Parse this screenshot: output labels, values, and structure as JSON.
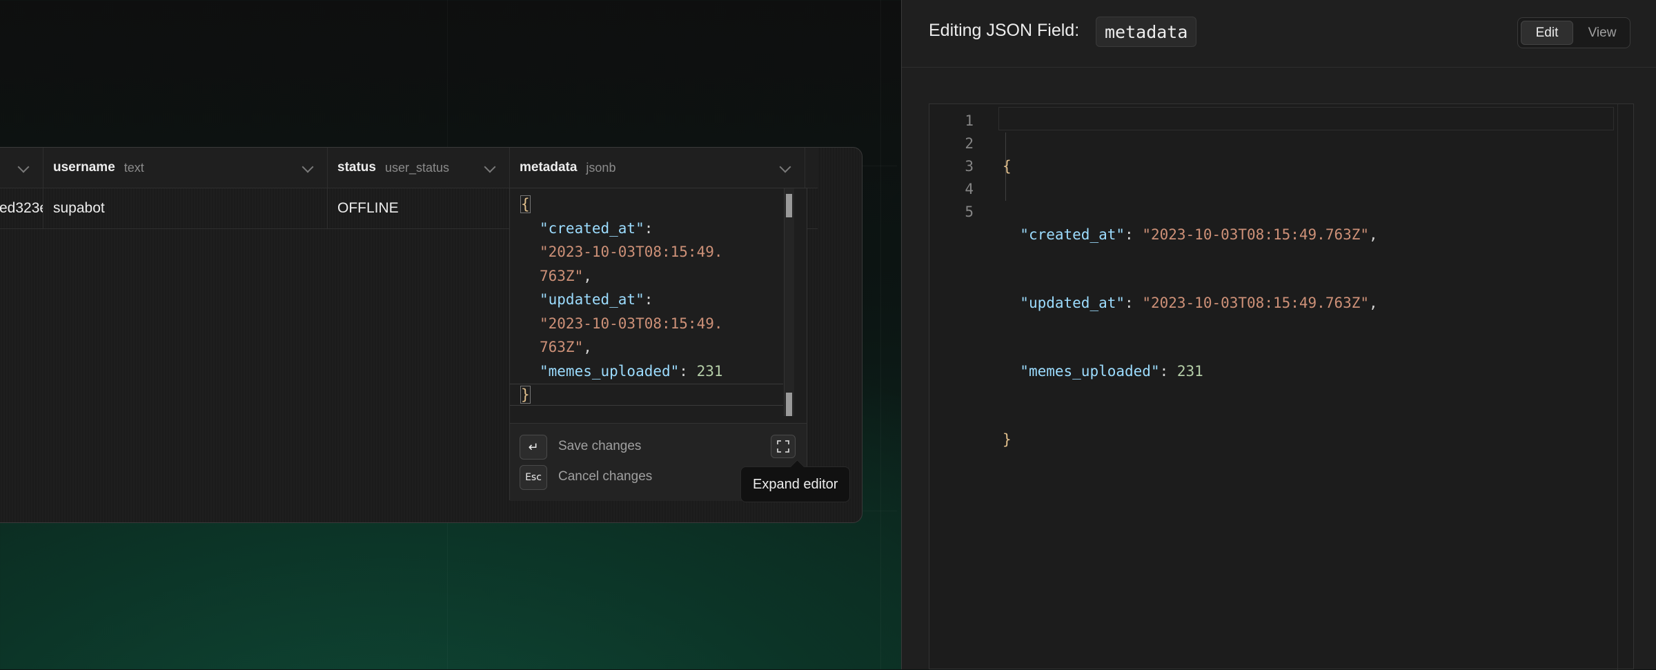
{
  "grid": {
    "columns": [
      {
        "name": "",
        "type": ""
      },
      {
        "name": "username",
        "type": "text"
      },
      {
        "name": "status",
        "type": "user_status"
      },
      {
        "name": "metadata",
        "type": "jsonb"
      }
    ],
    "row": {
      "id_partial": "ed323e",
      "username": "supabot",
      "status": "OFFLINE"
    }
  },
  "inline_editor": {
    "lines": {
      "open_brace": "{",
      "created_at_key": "\"created_at\"",
      "created_at_val_1": "\"2023-10-03T08:15:49.",
      "created_at_val_2": "763Z\"",
      "updated_at_key": "\"updated_at\"",
      "updated_at_val_1": "\"2023-10-03T08:15:49.",
      "updated_at_val_2": "763Z\"",
      "memes_key": "\"memes_uploaded\"",
      "memes_val": "231",
      "close_brace": "}"
    },
    "save_key": "↵",
    "save_label": "Save changes",
    "cancel_key": "Esc",
    "cancel_label": "Cancel changes",
    "expand_tooltip": "Expand editor"
  },
  "side_panel": {
    "title": "Editing JSON Field:",
    "field_name": "metadata",
    "mode_tabs": {
      "edit": "Edit",
      "view": "View",
      "active": "Edit"
    },
    "line_numbers": [
      "1",
      "2",
      "3",
      "4",
      "5"
    ],
    "json": {
      "created_at": "2023-10-03T08:15:49.763Z",
      "updated_at": "2023-10-03T08:15:49.763Z",
      "memes_uploaded": 231
    },
    "code": {
      "l1": "{",
      "k2": "\"created_at\"",
      "v2": "\"2023-10-03T08:15:49.763Z\"",
      "k3": "\"updated_at\"",
      "v3": "\"2023-10-03T08:15:49.763Z\"",
      "k4": "\"memes_uploaded\"",
      "v4": "231",
      "l5": "}"
    }
  },
  "colors": {
    "accent_green": "#0f4a37",
    "json_key": "#9cdcfe",
    "json_string": "#ce9178",
    "json_number": "#b5cea8"
  }
}
